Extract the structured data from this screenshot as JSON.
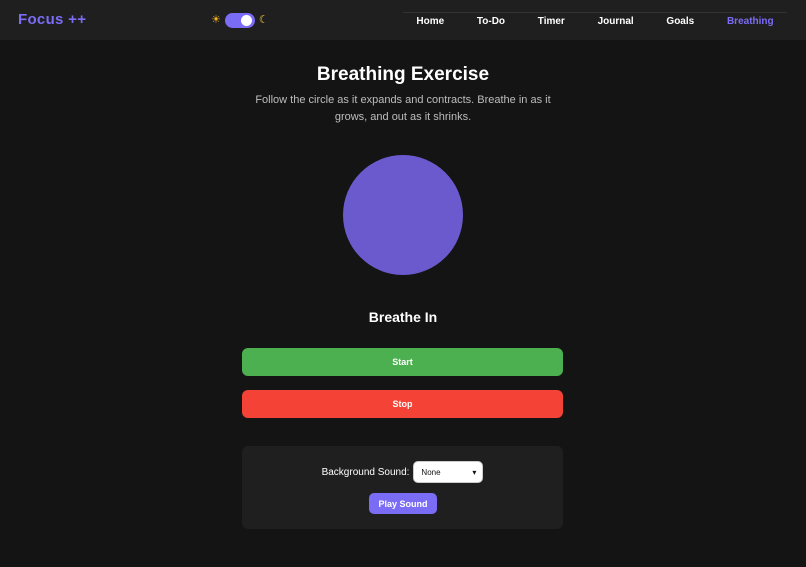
{
  "nav": {
    "brand": "Focus ++",
    "links": [
      "Home",
      "To-Do",
      "Timer",
      "Journal",
      "Goals",
      "Breathing"
    ],
    "active": "Breathing"
  },
  "theme": {
    "sun_icon": "☀",
    "moon_icon": "☾",
    "mode": "dark"
  },
  "main": {
    "title": "Breathing Exercise",
    "subtitle": "Follow the circle as it expands and contracts. Breathe in as it grows, and out as it shrinks.",
    "phase": "Breathe In",
    "start_label": "Start",
    "stop_label": "Stop"
  },
  "sound": {
    "label": "Background Sound:",
    "selected": "None",
    "play_label": "Play Sound"
  },
  "colors": {
    "accent": "#7b6cf6",
    "circle": "#6a5acd",
    "start": "#4caf50",
    "stop": "#f44336",
    "background": "#141414"
  }
}
